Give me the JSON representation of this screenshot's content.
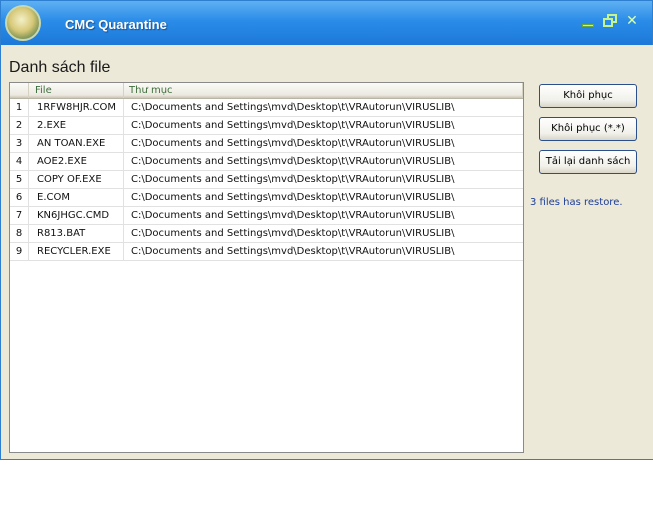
{
  "window": {
    "title": "CMC Quarantine",
    "minimize_glyph": "",
    "restore_glyph": "",
    "close_glyph": "✕"
  },
  "section": {
    "label": "Danh sách file"
  },
  "list": {
    "columns": {
      "file": "File",
      "folder": "Thư mục"
    },
    "rows": [
      {
        "num": "1",
        "file": "1RFW8HJR.COM",
        "folder": "C:\\Documents and Settings\\mvd\\Desktop\\t\\VRAutorun\\VIRUSLIB\\"
      },
      {
        "num": "2",
        "file": "2.EXE",
        "folder": "C:\\Documents and Settings\\mvd\\Desktop\\t\\VRAutorun\\VIRUSLIB\\"
      },
      {
        "num": "3",
        "file": "AN TOAN.EXE",
        "folder": "C:\\Documents and Settings\\mvd\\Desktop\\t\\VRAutorun\\VIRUSLIB\\"
      },
      {
        "num": "4",
        "file": "AOE2.EXE",
        "folder": "C:\\Documents and Settings\\mvd\\Desktop\\t\\VRAutorun\\VIRUSLIB\\"
      },
      {
        "num": "5",
        "file": "COPY OF.EXE",
        "folder": "C:\\Documents and Settings\\mvd\\Desktop\\t\\VRAutorun\\VIRUSLIB\\"
      },
      {
        "num": "6",
        "file": "E.COM",
        "folder": "C:\\Documents and Settings\\mvd\\Desktop\\t\\VRAutorun\\VIRUSLIB\\"
      },
      {
        "num": "7",
        "file": "KN6JHGC.CMD",
        "folder": "C:\\Documents and Settings\\mvd\\Desktop\\t\\VRAutorun\\VIRUSLIB\\"
      },
      {
        "num": "8",
        "file": "R813.BAT",
        "folder": "C:\\Documents and Settings\\mvd\\Desktop\\t\\VRAutorun\\VIRUSLIB\\"
      },
      {
        "num": "9",
        "file": "RECYCLER.EXE",
        "folder": "C:\\Documents and Settings\\mvd\\Desktop\\t\\VRAutorun\\VIRUSLIB\\"
      }
    ]
  },
  "buttons": {
    "restore": "Khôi phục",
    "restore_all": "Khôi phục (*.*)",
    "reload": "Tải lại danh sách"
  },
  "status": {
    "text": "3 files has restore."
  },
  "colors": {
    "titlebar": "#2a8ce8",
    "status_text": "#1b3d9b",
    "header_text": "#3e6d3e"
  }
}
